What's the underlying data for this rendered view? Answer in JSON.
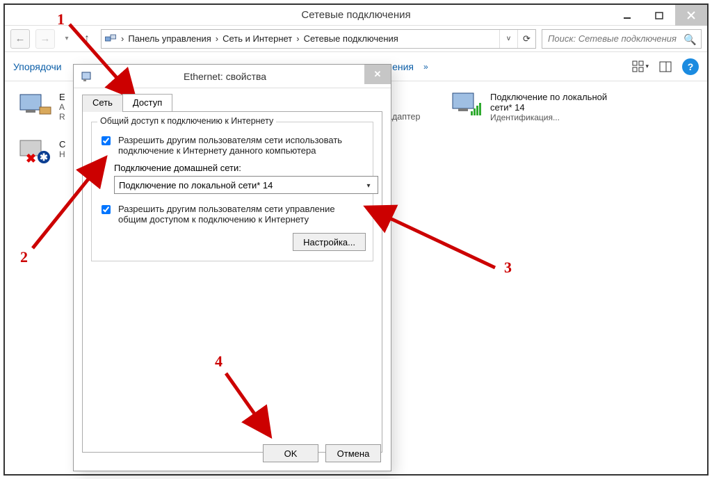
{
  "window": {
    "title": "Сетевые подключения"
  },
  "breadcrumb": {
    "items": [
      "Панель управления",
      "Сеть и Интернет",
      "Сетевые подключения"
    ]
  },
  "search": {
    "placeholder": "Поиск: Сетевые подключения"
  },
  "commands": {
    "organize": "Упорядочи",
    "connections": "ючения",
    "more": "»"
  },
  "net_items": {
    "a": {
      "l1": "E",
      "l2": "А",
      "l3": "R"
    },
    "b": {
      "l1": "С",
      "l2": "Н"
    },
    "c": {
      "l1": "Подключение по локальной",
      "l2": "сети* 14",
      "l3": "Идентификация..."
    },
    "d_tail": "адаптер"
  },
  "dialog": {
    "title": "Ethernet: свойства",
    "tabs": {
      "net": "Сеть",
      "share": "Доступ"
    },
    "legend": "Общий доступ к подключению к Интернету",
    "chk1": "Разрешить другим пользователям сети использовать подключение к Интернету данного компьютера",
    "home_label": "Подключение домашней сети:",
    "combo_value": "Подключение по локальной сети* 14",
    "chk2": "Разрешить другим пользователям сети управление общим доступом к подключению к Интернету",
    "settings_btn": "Настройка...",
    "ok": "OK",
    "cancel": "Отмена"
  },
  "annotations": {
    "n1": "1",
    "n2": "2",
    "n3": "3",
    "n4": "4"
  }
}
